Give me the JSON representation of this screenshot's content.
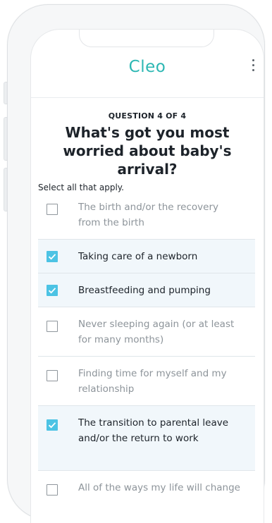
{
  "app": {
    "logo": "Cleo"
  },
  "question": {
    "eyebrow": "QUESTION 4 OF 4",
    "title": "What's got you most worried about baby's arrival?",
    "hint": "Select all that apply."
  },
  "options": [
    {
      "label": "The birth and/or the recovery from the birth",
      "checked": false
    },
    {
      "label": "Taking care of a newborn",
      "checked": true
    },
    {
      "label": "Breastfeeding and pumping",
      "checked": true
    },
    {
      "label": "Never sleeping again (or at least for many months)",
      "checked": false
    },
    {
      "label": "Finding time for myself and my relationship",
      "checked": false
    },
    {
      "label": "The transition to parental leave and/or the return to work",
      "checked": true
    },
    {
      "label": "All of the ways my life will change",
      "checked": false
    }
  ],
  "colors": {
    "brand": "#2cb7b3",
    "check": "#4cc3e4",
    "selected_row": "#f1f7fb"
  }
}
